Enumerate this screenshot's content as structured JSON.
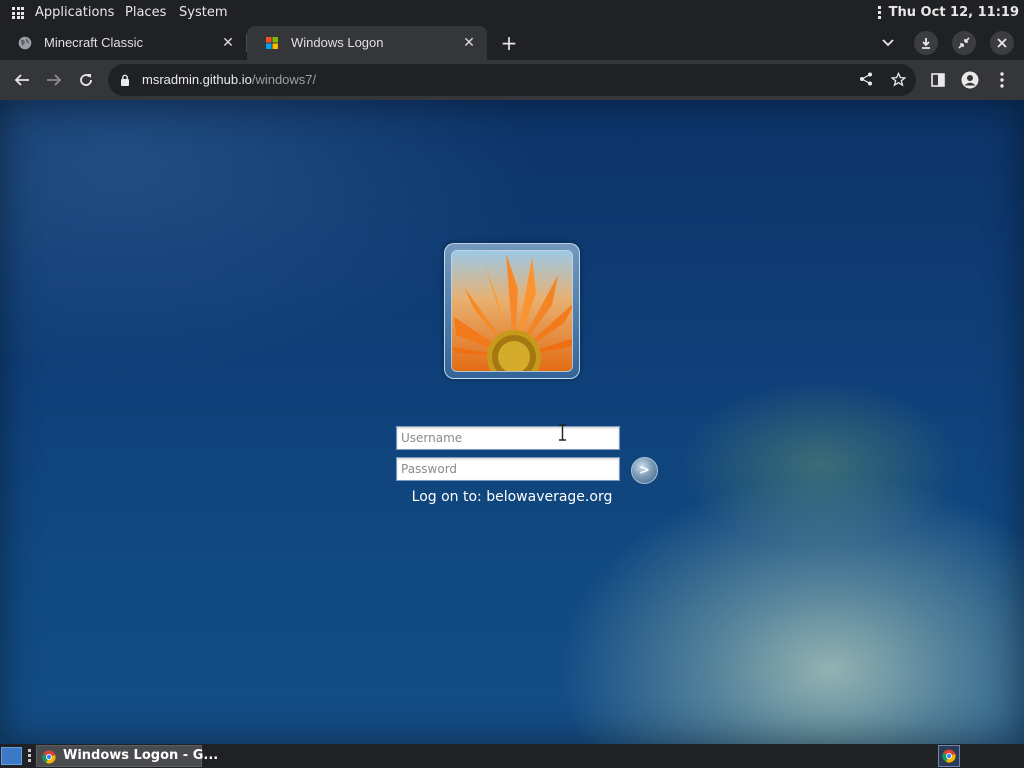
{
  "top_panel": {
    "menus": [
      "Applications",
      "Places",
      "System"
    ],
    "clock": "Thu Oct 12, 11:19"
  },
  "tabs": [
    {
      "title": "Minecraft Classic",
      "favicon": "globe-icon",
      "active": false
    },
    {
      "title": "Windows Logon",
      "favicon": "windows-logo-icon",
      "active": true
    }
  ],
  "tabstrip_icons": [
    "plus-icon",
    "chevron-down-icon",
    "download-icon",
    "restore-icon",
    "close-icon"
  ],
  "toolbar": {
    "url_host": "msradmin.github.io",
    "url_path": "/windows7/",
    "icons": [
      "back-arrow-icon",
      "forward-arrow-icon",
      "reload-icon",
      "lock-icon",
      "share-icon",
      "star-icon",
      "side-panel-icon",
      "profile-icon",
      "kebab-menu-icon"
    ]
  },
  "logon": {
    "avatar": "orange-flower-avatar",
    "username_placeholder": "Username",
    "password_placeholder": "Password",
    "go_label": ">",
    "logon_to": "Log on to: belowaverage.org"
  },
  "taskbar": {
    "task_label": "Windows Logon - G...",
    "tray_icon": "chrome-icon"
  },
  "colors": {
    "panel_bg": "#202124",
    "toolbar_bg": "#35363a",
    "wallpaper_blue": "#0f3f78",
    "wallpaper_glow": "#aac4ba"
  }
}
